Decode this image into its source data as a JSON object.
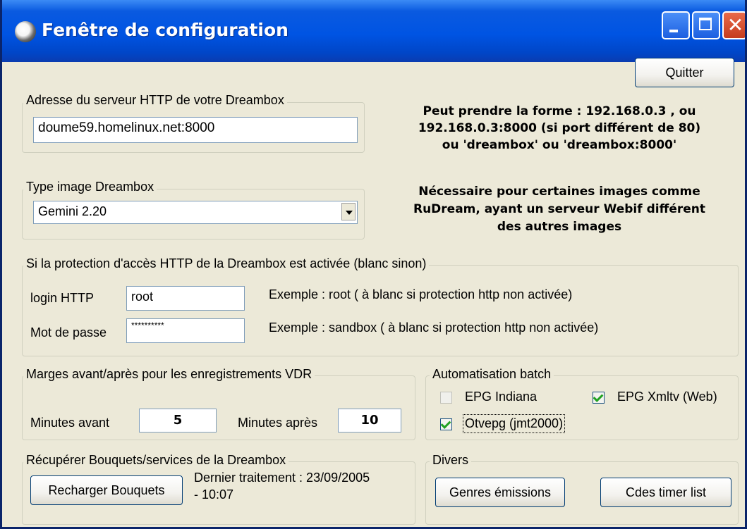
{
  "window": {
    "title": "Fenêtre de configuration"
  },
  "buttons": {
    "quit": "Quitter",
    "reload": "Recharger Bouquets",
    "genres": "Genres émissions",
    "timer": "Cdes timer list"
  },
  "server": {
    "group_title": "Adresse du serveur HTTP de votre Dreambox",
    "value": "doume59.homelinux.net:8000",
    "hint": [
      "Peut prendre la forme : 192.168.0.3 , ou",
      "192.168.0.3:8000 (si port différent de 80)",
      "ou 'dreambox'  ou 'dreambox:8000'"
    ]
  },
  "image_type": {
    "group_title": "Type image Dreambox",
    "value": "Gemini 2.20",
    "hint": [
      "Nécessaire pour certaines images comme",
      "RuDream, ayant un serveur Webif différent",
      "des autres images"
    ]
  },
  "protection": {
    "group_title": "Si la protection d'accès HTTP de la Dreambox est activée (blanc sinon)",
    "login_label": "login HTTP",
    "login_value": "root",
    "login_example": "Exemple : root  ( à blanc si protection http non activée)",
    "password_label": "Mot de passe",
    "password_value": "**********",
    "password_example": "Exemple : sandbox  ( à blanc si protection http non activée)"
  },
  "margins": {
    "group_title": "Marges avant/après pour les enregistrements VDR",
    "before_label": "Minutes avant",
    "before_value": "5",
    "after_label": "Minutes après",
    "after_value": "10"
  },
  "batch": {
    "group_title": "Automatisation batch",
    "epg_indiana": "EPG Indiana",
    "epg_xmltv": "EPG Xmltv (Web)",
    "otvepg": "Otvepg (jmt2000)"
  },
  "bouquets": {
    "group_title": "Récupérer Bouquets/services de la Dreambox",
    "last_line1": "Dernier traitement : 23/09/2005",
    "last_line2": "- 10:07"
  },
  "divers": {
    "group_title": "Divers"
  }
}
